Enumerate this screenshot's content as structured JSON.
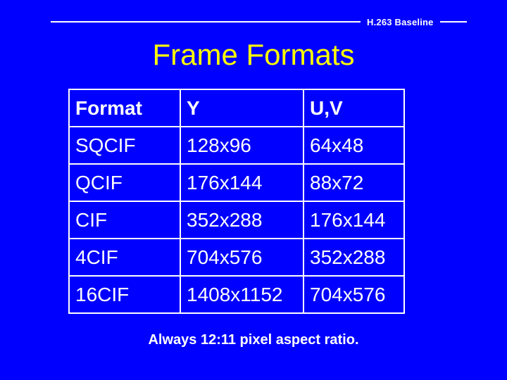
{
  "slide": {
    "background_color": "#0000FF",
    "header": {
      "label": "H.263 Baseline",
      "label_color": "#FFFFFF",
      "rule_color": "#FFFFFF"
    },
    "title": {
      "text": "Frame Formats",
      "color": "#FFFF00"
    },
    "table": {
      "border_color": "#FFFFFF",
      "text_color": "#FFFFFF",
      "columns": [
        "Format",
        "Y",
        "U,V"
      ],
      "rows": [
        {
          "format": "SQCIF",
          "y": "128x96",
          "uv": "64x48"
        },
        {
          "format": "QCIF",
          "y": "176x144",
          "uv": "88x72"
        },
        {
          "format": "CIF",
          "y": "352x288",
          "uv": "176x144"
        },
        {
          "format": "4CIF",
          "y": "704x576",
          "uv": "352x288"
        },
        {
          "format": "16CIF",
          "y": "1408x1152",
          "uv": "704x576"
        }
      ]
    },
    "footer": {
      "text": "Always 12:11 pixel aspect ratio.",
      "color": "#FFFFFF"
    }
  }
}
